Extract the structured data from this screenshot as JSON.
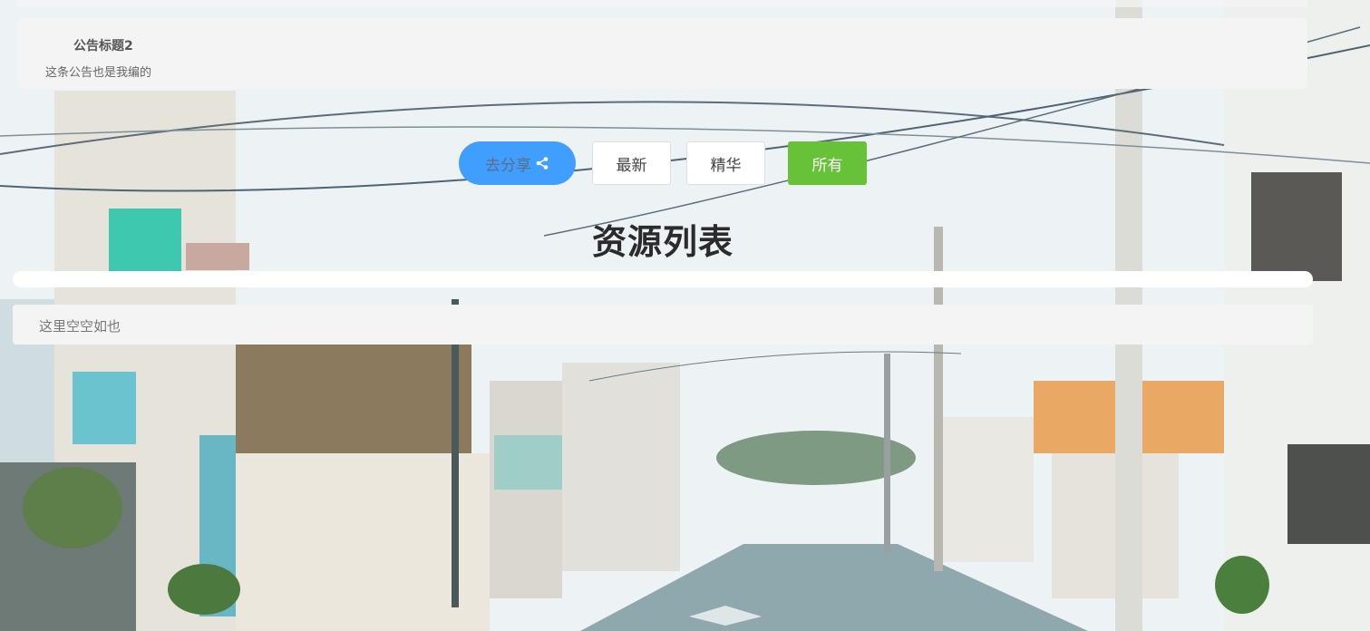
{
  "notice": {
    "title": "公告标题2",
    "body": "这条公告也是我编的"
  },
  "actions": {
    "share_label": "去分享",
    "share_icon": "share-icon",
    "latest_label": "最新",
    "featured_label": "精华",
    "all_label": "所有"
  },
  "resources": {
    "title": "资源列表",
    "empty_text": "这里空空如也"
  },
  "colors": {
    "share_button": "#409eff",
    "all_button": "#67c23a",
    "card_background": "#f4f4f4"
  }
}
